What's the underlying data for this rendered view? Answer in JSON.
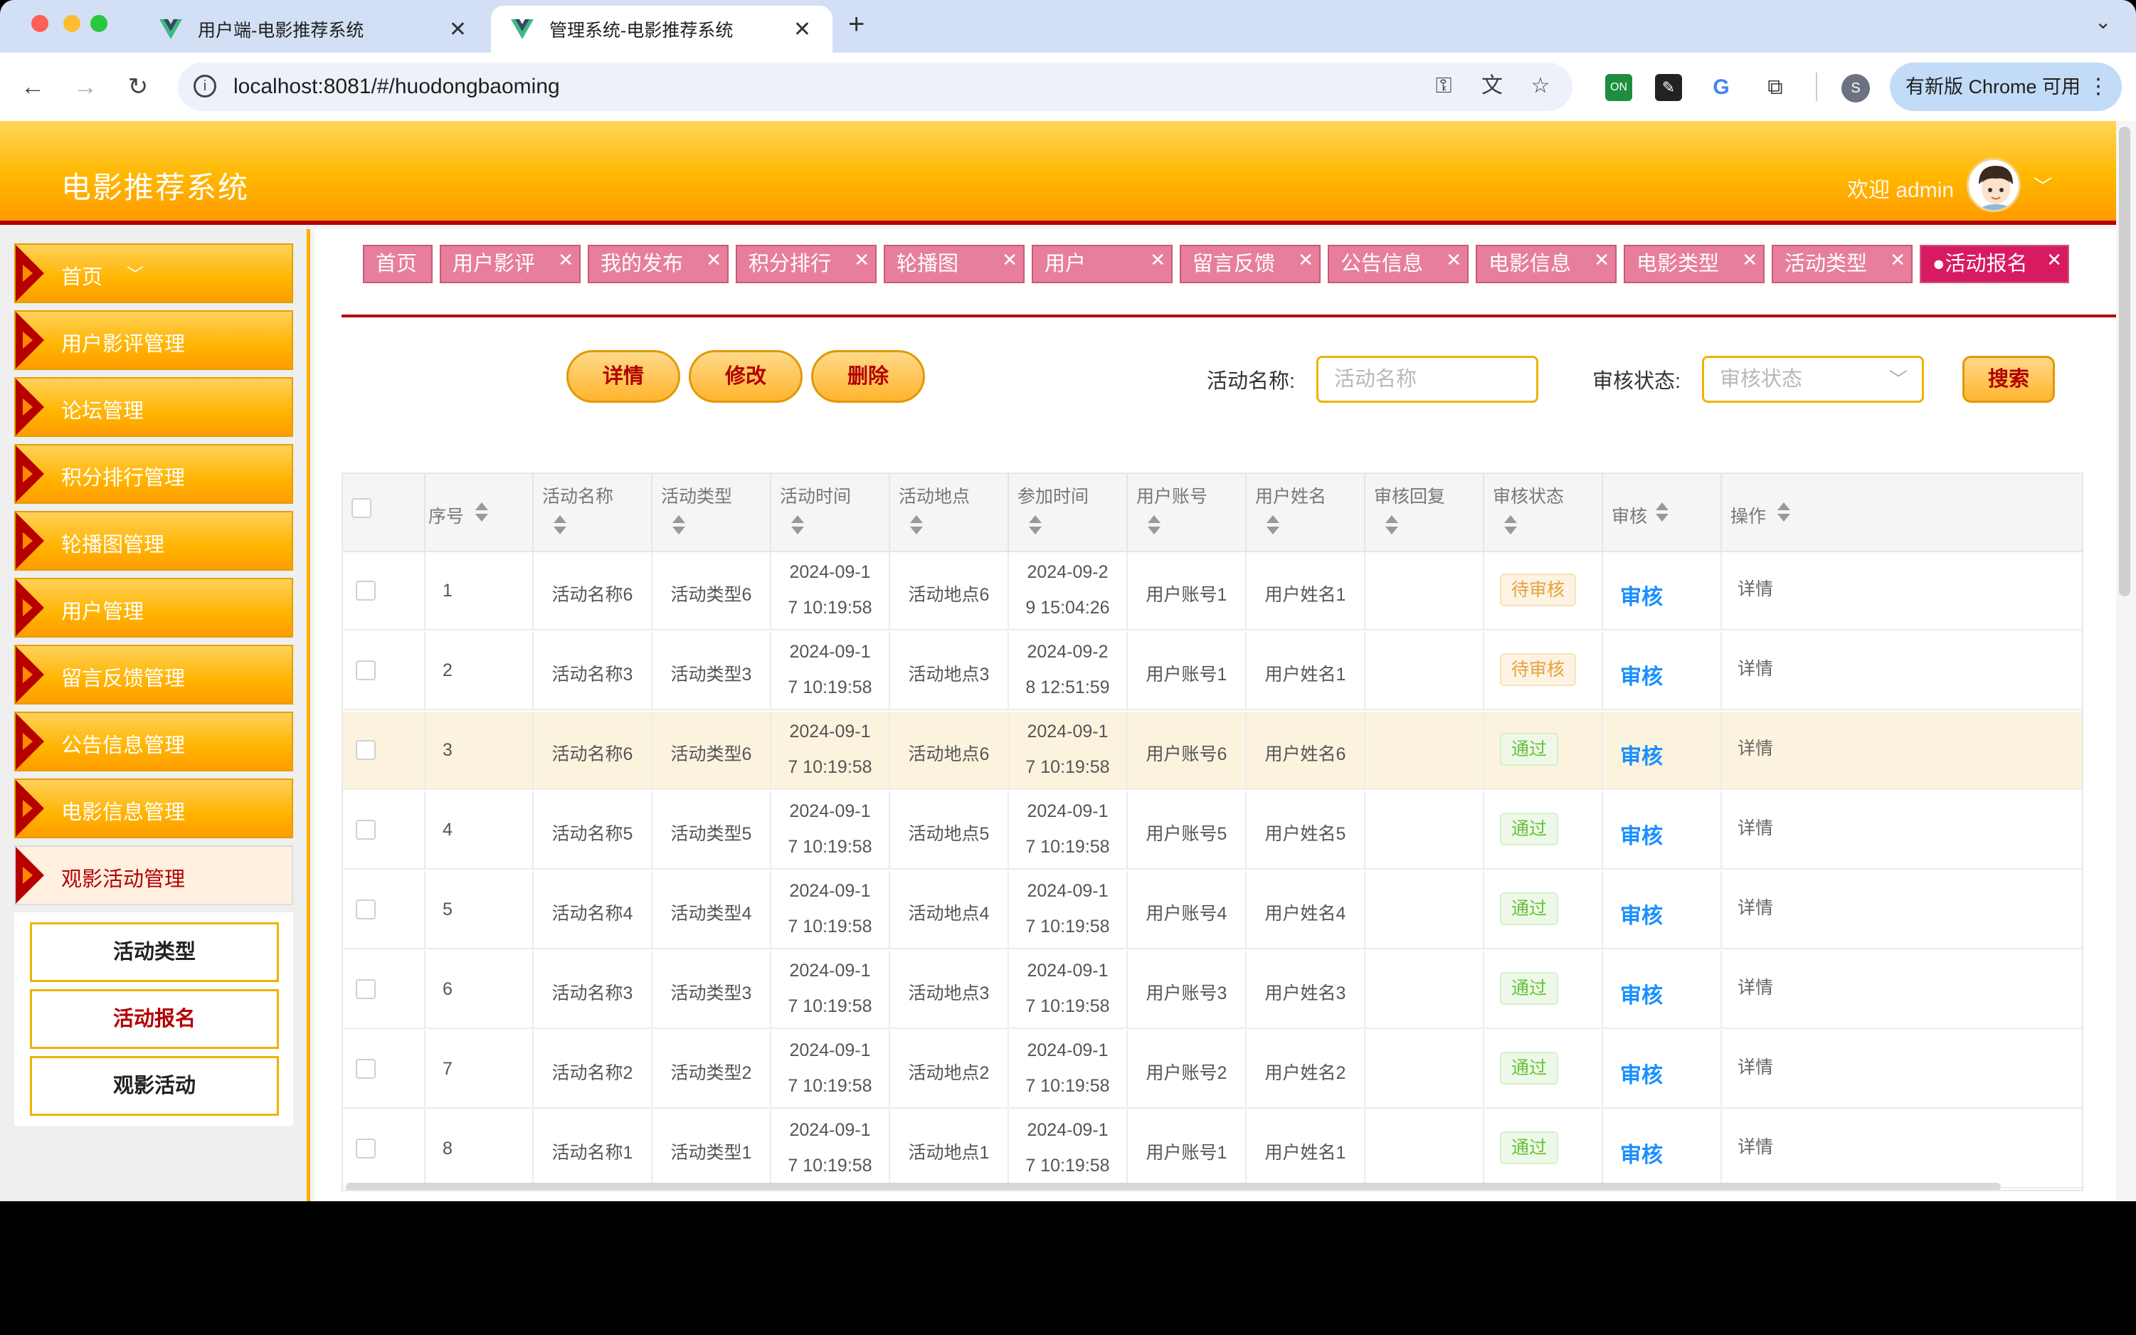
{
  "browser": {
    "tabs": [
      {
        "title": "用户端-电影推荐系统",
        "active": false
      },
      {
        "title": "管理系统-电影推荐系统",
        "active": true
      }
    ],
    "new_tab_icon": "+",
    "url": "localhost:8081/#/huodongbaoming",
    "update_button": "有新版 Chrome 可用",
    "profile_initial": "S"
  },
  "app": {
    "title": "电影推荐系统",
    "welcome": "欢迎 admin"
  },
  "sidebar": {
    "items": [
      {
        "label": "首页",
        "chevron": "﹀"
      },
      {
        "label": "用户影评管理"
      },
      {
        "label": "论坛管理"
      },
      {
        "label": "积分排行管理"
      },
      {
        "label": "轮播图管理"
      },
      {
        "label": "用户管理"
      },
      {
        "label": "留言反馈管理"
      },
      {
        "label": "公告信息管理"
      },
      {
        "label": "电影信息管理"
      },
      {
        "label": "观影活动管理"
      }
    ],
    "submenu": [
      {
        "label": "活动类型"
      },
      {
        "label": "活动报名"
      },
      {
        "label": "观影活动"
      }
    ]
  },
  "breadcrumbs": [
    {
      "label": "首页"
    },
    {
      "label": "用户影评"
    },
    {
      "label": "我的发布"
    },
    {
      "label": "积分排行"
    },
    {
      "label": "轮播图"
    },
    {
      "label": "用户"
    },
    {
      "label": "留言反馈"
    },
    {
      "label": "公告信息"
    },
    {
      "label": "电影信息"
    },
    {
      "label": "电影类型"
    },
    {
      "label": "活动类型"
    },
    {
      "label": "●活动报名"
    }
  ],
  "close_glyph": "✕",
  "actions": {
    "detail": "详情",
    "edit": "修改",
    "delete": "删除"
  },
  "filters": {
    "name_label": "活动名称:",
    "name_placeholder": "活动名称",
    "status_label": "审核状态:",
    "status_placeholder": "审核状态",
    "search": "搜索"
  },
  "table": {
    "columns": [
      "序号",
      "活动名称",
      "活动类型",
      "活动时间",
      "活动地点",
      "参加时间",
      "用户账号",
      "用户姓名",
      "审核回复",
      "审核状态",
      "审核",
      "操作"
    ],
    "audit_label": "审核",
    "detail_label": "详情",
    "rows": [
      {
        "seq": "1",
        "name": "活动名称6",
        "type": "活动类型6",
        "time1": "2024-09-1",
        "time2": "7 10:19:58",
        "place": "活动地点6",
        "join1": "2024-09-2",
        "join2": "9 15:04:26",
        "account": "用户账号1",
        "uname": "用户姓名1",
        "reply": "",
        "status": "待审核",
        "status_kind": "pending"
      },
      {
        "seq": "2",
        "name": "活动名称3",
        "type": "活动类型3",
        "time1": "2024-09-1",
        "time2": "7 10:19:58",
        "place": "活动地点3",
        "join1": "2024-09-2",
        "join2": "8 12:51:59",
        "account": "用户账号1",
        "uname": "用户姓名1",
        "reply": "",
        "status": "待审核",
        "status_kind": "pending"
      },
      {
        "seq": "3",
        "name": "活动名称6",
        "type": "活动类型6",
        "time1": "2024-09-1",
        "time2": "7 10:19:58",
        "place": "活动地点6",
        "join1": "2024-09-1",
        "join2": "7 10:19:58",
        "account": "用户账号6",
        "uname": "用户姓名6",
        "reply": "",
        "status": "通过",
        "status_kind": "pass",
        "highlight": true
      },
      {
        "seq": "4",
        "name": "活动名称5",
        "type": "活动类型5",
        "time1": "2024-09-1",
        "time2": "7 10:19:58",
        "place": "活动地点5",
        "join1": "2024-09-1",
        "join2": "7 10:19:58",
        "account": "用户账号5",
        "uname": "用户姓名5",
        "reply": "",
        "status": "通过",
        "status_kind": "pass"
      },
      {
        "seq": "5",
        "name": "活动名称4",
        "type": "活动类型4",
        "time1": "2024-09-1",
        "time2": "7 10:19:58",
        "place": "活动地点4",
        "join1": "2024-09-1",
        "join2": "7 10:19:58",
        "account": "用户账号4",
        "uname": "用户姓名4",
        "reply": "",
        "status": "通过",
        "status_kind": "pass"
      },
      {
        "seq": "6",
        "name": "活动名称3",
        "type": "活动类型3",
        "time1": "2024-09-1",
        "time2": "7 10:19:58",
        "place": "活动地点3",
        "join1": "2024-09-1",
        "join2": "7 10:19:58",
        "account": "用户账号3",
        "uname": "用户姓名3",
        "reply": "",
        "status": "通过",
        "status_kind": "pass"
      },
      {
        "seq": "7",
        "name": "活动名称2",
        "type": "活动类型2",
        "time1": "2024-09-1",
        "time2": "7 10:19:58",
        "place": "活动地点2",
        "join1": "2024-09-1",
        "join2": "7 10:19:58",
        "account": "用户账号2",
        "uname": "用户姓名2",
        "reply": "",
        "status": "通过",
        "status_kind": "pass"
      },
      {
        "seq": "8",
        "name": "活动名称1",
        "type": "活动类型1",
        "time1": "2024-09-1",
        "time2": "7 10:19:58",
        "place": "活动地点1",
        "join1": "2024-09-1",
        "join2": "7 10:19:58",
        "account": "用户账号1",
        "uname": "用户姓名1",
        "reply": "",
        "status": "通过",
        "status_kind": "pass"
      }
    ]
  },
  "colors": {
    "accent": "#ffb400",
    "brand_red": "#b30000",
    "tab_pink": "#e77f9c",
    "pending": "#e6a23c",
    "pass": "#67c23a",
    "link": "#1a8fff"
  }
}
